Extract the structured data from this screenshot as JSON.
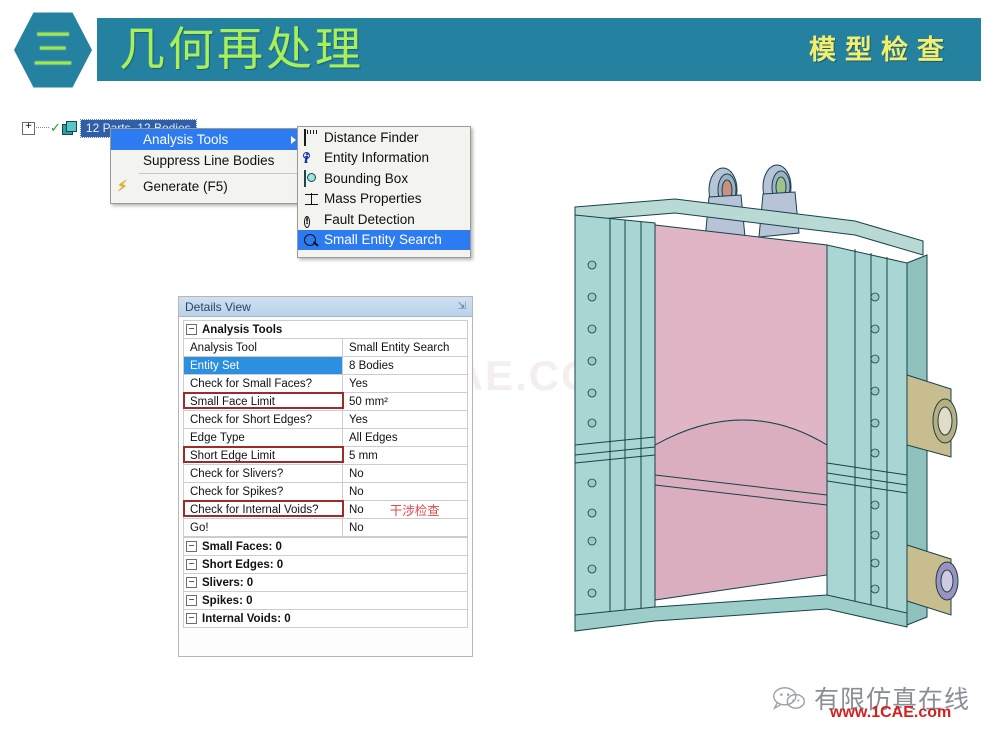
{
  "header": {
    "section_number": "三",
    "title_cn": "几何再处理",
    "title_right_cn": "模型检查",
    "accent_color": "#2481a0",
    "title_text_color": "#a8f05a",
    "right_text_color": "#f2ef70"
  },
  "tree": {
    "expander": "+",
    "check_icon": "check-icon",
    "body_icon": "cube-icon",
    "label": "12 Parts, 12 Bodies"
  },
  "context_menu": {
    "items": [
      {
        "label": "Analysis Tools",
        "selected": true,
        "has_submenu": true,
        "icon": ""
      },
      {
        "label": "Suppress Line Bodies",
        "selected": false,
        "has_submenu": false,
        "icon": ""
      },
      {
        "label": "Generate (F5)",
        "selected": false,
        "has_submenu": false,
        "icon": "lightning-icon"
      }
    ]
  },
  "submenu": {
    "items": [
      {
        "label": "Distance Finder",
        "icon": "ruler-icon",
        "selected": false
      },
      {
        "label": "Entity Information",
        "icon": "info-icon",
        "selected": false
      },
      {
        "label": "Bounding Box",
        "icon": "cube-icon",
        "selected": false
      },
      {
        "label": "Mass Properties",
        "icon": "scale-icon",
        "selected": false
      },
      {
        "label": "Fault Detection",
        "icon": "warning-circle-icon",
        "selected": false
      },
      {
        "label": "Small Entity Search",
        "icon": "magnifier-icon",
        "selected": true
      }
    ]
  },
  "details_view": {
    "title": "Details View",
    "pin": "⇲",
    "group_header": "Analysis Tools",
    "rows": [
      {
        "label": "Analysis Tool",
        "value": "Small Entity Search",
        "selected": false,
        "highlighted": false,
        "note": ""
      },
      {
        "label": "Entity Set",
        "value": "8 Bodies",
        "selected": true,
        "highlighted": false,
        "note": ""
      },
      {
        "label": "Check for Small Faces?",
        "value": "Yes",
        "selected": false,
        "highlighted": false,
        "note": ""
      },
      {
        "label": "Small Face Limit",
        "value": "50 mm²",
        "selected": false,
        "highlighted": true,
        "note": ""
      },
      {
        "label": "Check for Short Edges?",
        "value": "Yes",
        "selected": false,
        "highlighted": false,
        "note": ""
      },
      {
        "label": "Edge Type",
        "value": "All Edges",
        "selected": false,
        "highlighted": false,
        "note": ""
      },
      {
        "label": "Short Edge Limit",
        "value": "5 mm",
        "selected": false,
        "highlighted": true,
        "note": ""
      },
      {
        "label": "Check for Slivers?",
        "value": "No",
        "selected": false,
        "highlighted": false,
        "note": ""
      },
      {
        "label": "Check for Spikes?",
        "value": "No",
        "selected": false,
        "highlighted": false,
        "note": ""
      },
      {
        "label": "Check for Internal Voids?",
        "value": "No",
        "selected": false,
        "highlighted": true,
        "note": "干涉检查"
      },
      {
        "label": "Go!",
        "value": "No",
        "selected": false,
        "highlighted": false,
        "note": ""
      }
    ],
    "result_groups": [
      {
        "label": "Small Faces: 0"
      },
      {
        "label": "Short Edges: 0"
      },
      {
        "label": "Slivers: 0"
      },
      {
        "label": "Spikes: 0"
      },
      {
        "label": "Internal Voids: 0"
      }
    ],
    "highlight_color": "#9e2a2a",
    "note_color": "#e04a4a"
  },
  "model": {
    "name": "cad-assembly-frame",
    "side_plate_color": "#a9d6d2",
    "center_web_color": "#e0b6c6",
    "lug_color": "#b7c3d6",
    "boss_color": "#c8bd8e"
  },
  "watermarks": {
    "center": "1CAE.COM",
    "footer_cn": "有限仿真在线",
    "footer_url": "www.1CAE.com"
  }
}
